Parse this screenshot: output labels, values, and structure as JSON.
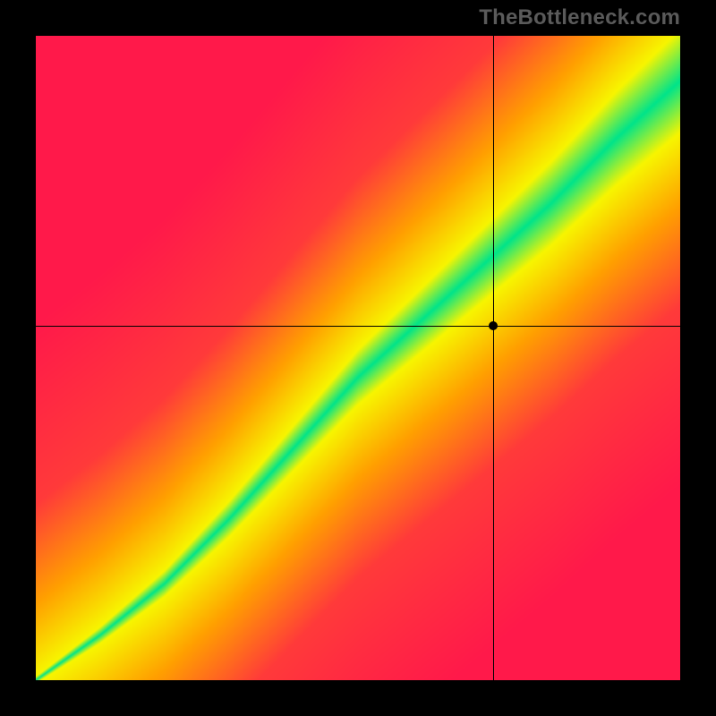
{
  "watermark": "TheBottleneck.com",
  "chart_data": {
    "type": "heatmap",
    "title": "",
    "xlabel": "",
    "ylabel": "",
    "xlim": [
      0,
      1
    ],
    "ylim": [
      0,
      1
    ],
    "crosshair": {
      "x": 0.71,
      "y": 0.55
    },
    "marker": {
      "x": 0.71,
      "y": 0.55
    },
    "optimal_band": {
      "description": "green diagonal band where GPU and CPU are balanced",
      "curve_points_xy": [
        [
          0.0,
          0.0
        ],
        [
          0.1,
          0.07
        ],
        [
          0.2,
          0.15
        ],
        [
          0.3,
          0.25
        ],
        [
          0.4,
          0.36
        ],
        [
          0.5,
          0.47
        ],
        [
          0.6,
          0.56
        ],
        [
          0.7,
          0.65
        ],
        [
          0.8,
          0.74
        ],
        [
          0.9,
          0.84
        ],
        [
          1.0,
          0.93
        ]
      ],
      "band_halfwidth_fraction_start": 0.005,
      "band_halfwidth_fraction_end": 0.08
    },
    "color_scale": {
      "description": "distance from optimal band maps red→orange→yellow→green",
      "stops": [
        {
          "d": 0.0,
          "color": "#00E48A"
        },
        {
          "d": 0.12,
          "color": "#F7F500"
        },
        {
          "d": 0.3,
          "color": "#FFA000"
        },
        {
          "d": 0.55,
          "color": "#FF3A3A"
        },
        {
          "d": 1.0,
          "color": "#FF194A"
        }
      ]
    }
  }
}
